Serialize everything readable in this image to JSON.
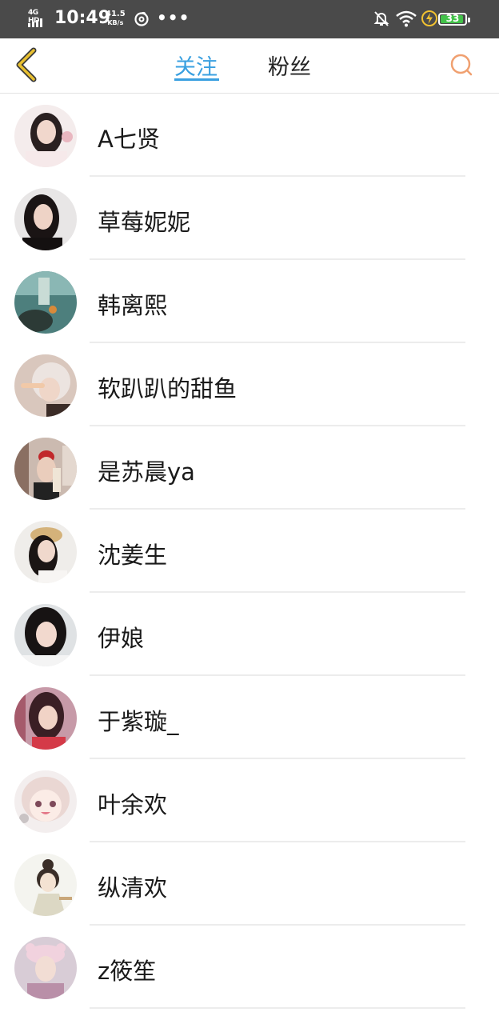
{
  "status_bar": {
    "network": "4G HD",
    "time": "10:49",
    "speed_value": "41.5",
    "speed_unit": "KB/s",
    "icons": [
      "signal-icon",
      "netease-music-icon",
      "more-dots-icon",
      "mute-bell-icon",
      "wifi-icon",
      "charging-icon",
      "battery-icon"
    ],
    "battery_level": "33"
  },
  "header": {
    "back_icon": "chevron-left-icon",
    "tabs": [
      {
        "label": "关注",
        "active": true
      },
      {
        "label": "粉丝",
        "active": false
      }
    ],
    "search_icon": "search-icon",
    "accent_color": "#3aa0e0",
    "back_color": "#e0b020",
    "search_color": "#f0a070"
  },
  "users": [
    {
      "name": "A七贤"
    },
    {
      "name": "草莓妮妮"
    },
    {
      "name": "韩离熙"
    },
    {
      "name": "软趴趴的甜鱼"
    },
    {
      "name": "是苏晨ya"
    },
    {
      "name": "沈姜生"
    },
    {
      "name": "伊娘"
    },
    {
      "name": "于紫璇_"
    },
    {
      "name": "叶余欢"
    },
    {
      "name": "纵清欢"
    },
    {
      "name": "z筱笙"
    }
  ]
}
